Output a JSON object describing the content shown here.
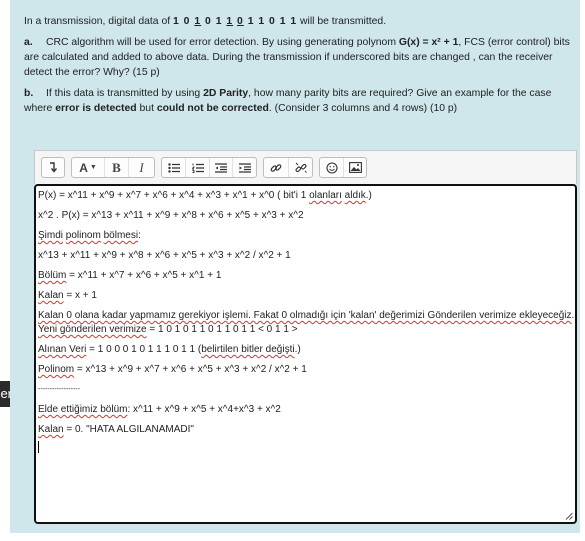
{
  "question": {
    "intro_pre": "In a transmission, digital data of ",
    "data_parts": [
      "1 0 ",
      "1",
      " 0 1 ",
      "1",
      " ",
      "0",
      " 1 1 0 1 1"
    ],
    "intro_post": " will be transmitted.",
    "a": {
      "label": "a.",
      "t1": "CRC algorithm will be used for error detection. By using generating polynom ",
      "poly": "G(x) = x² + 1",
      "t2": ", FCS (error control) bits are calculated and added to above data. During the transmission if  underscored bits are changed , can the receiver detect the error? Why? (15 p)"
    },
    "b": {
      "label": "b.",
      "t1": "If this data is transmitted by using ",
      "parity": "2D Parity",
      "t2": ", how many parity bits are required? Give an example for the case where ",
      "detected": "error is detected",
      "t3": " but ",
      "notcorrected": "could not be corrected",
      "t4": ". (Consider 3 columns and 4 rows) (10 p)"
    }
  },
  "toolbar": {
    "format_icon": "format-arrow-icon",
    "font_label": "A",
    "bold_label": "B",
    "italic_label": "I",
    "icons": [
      "unordered-list-icon",
      "ordered-list-icon",
      "outdent-icon",
      "indent-icon",
      "link-icon",
      "unlink-icon",
      "emoji-icon",
      "image-icon"
    ]
  },
  "answer": {
    "l1_pre": "P(x) = x^11 + x^9 + x^7 + x^6 + x^4 + x^3 + x^1 + x^0 ( bit'i 1 ",
    "l1_sq1": "olanları",
    "l1_sp": " ",
    "l1_sq2": "aldık",
    "l1_post": ".)",
    "l2": "x^2 . P(x) = x^13 + x^11 + x^9 + x^8 + x^6 + x^5 + x^3 + x^2",
    "l3_sq1": "Şimdi",
    "l3_sp": " ",
    "l3_sq2": "polinom",
    "l3_sp2": " ",
    "l3_sq3": "bölmesi",
    "l3_post": ":",
    "l4": " x^13 + x^11 + x^9 + x^8 + x^6 + x^5 + x^3 + x^2 / x^2 + 1",
    "l5_sq": "Bölüm",
    "l5_post": " = x^11 + x^7 + x^6 + x^5 + x^1 + 1",
    "l6_sq": "Kalan",
    "l6_post": " = x + 1",
    "l7_sq": "Kalan 0 olana kadar yapmamız gerekiyor işlemi. Fakat 0 olmadığı için 'kalan' değerimizi Gönderilen verimize ekleyeceğiz",
    "l7_post": ".",
    "l8_sq": "Yeni gönderilen verimize",
    "l8_post": " =  1 0 1 0 1 1 0 1 1 0 1 1 < 0 1 1 >",
    "l9_sq1": "Alınan Veri",
    "l9_mid": " = 1 0 0 0 1 0 1 1 1 0 1 1 (",
    "l9_sq2": "belirtilen bitler değişti",
    "l9_post": ".)",
    "l10_sq": "Polinom",
    "l10_post": " = x^13 + x^9 + x^7 + x^6 + x^5 + x^3 + x^2 / x^2 + 1",
    "l11": "------------------",
    "l12_sq": "Elde ettiğimiz bölüm",
    "l12_post": ": x^11 + x^9 + x^5 + x^4+x^3 + x^2",
    "l13_sq": "Kalan",
    "l13_post": " = 0. \"HATA ALGILANAMADI\""
  },
  "side_tab": {
    "label": "er"
  }
}
